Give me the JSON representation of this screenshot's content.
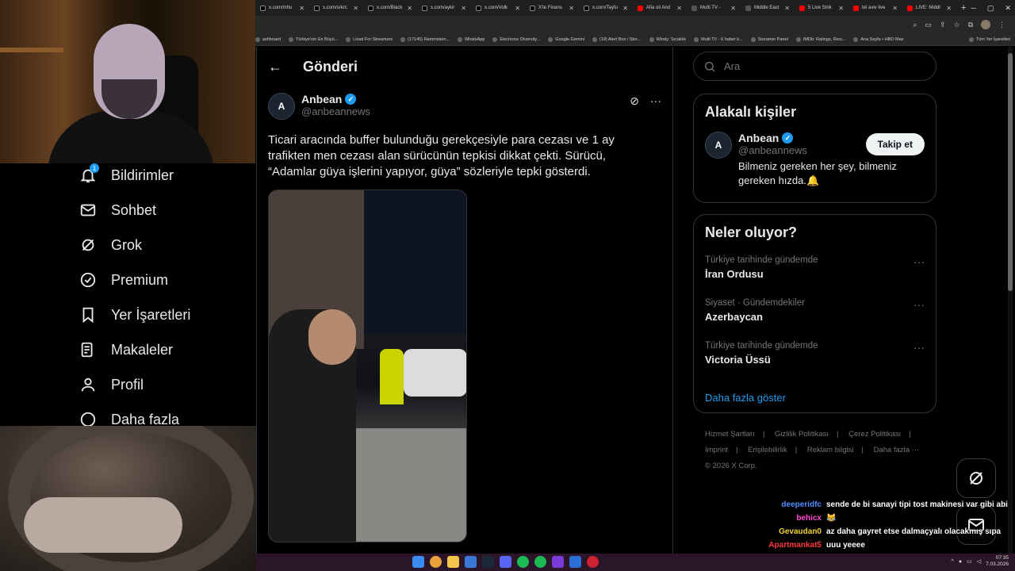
{
  "browser": {
    "tabs": [
      {
        "label": "x.com/mhu",
        "kind": "x"
      },
      {
        "label": "x.com/srkrc",
        "kind": "x"
      },
      {
        "label": "x.com/Black",
        "kind": "x"
      },
      {
        "label": "x.com/aykir",
        "kind": "x"
      },
      {
        "label": "x.com/Volk",
        "kind": "x"
      },
      {
        "label": "X'te Finans",
        "kind": "x"
      },
      {
        "label": "x.com/Tayfu",
        "kind": "x"
      },
      {
        "label": "Afia oil And",
        "kind": "yt"
      },
      {
        "label": "Multi TV -",
        "kind": "plain"
      },
      {
        "label": "Middle East",
        "kind": "plain"
      },
      {
        "label": "5 Live Strik",
        "kind": "yt"
      },
      {
        "label": "tel aviv live",
        "kind": "yt"
      },
      {
        "label": "LIVE: Middl",
        "kind": "yt"
      }
    ],
    "new_tab": "+",
    "bookmarks": [
      "ashboard",
      "Türkiye'nin En Büyü...",
      "Livad For Streamers",
      "(17145) Rammstein...",
      "WhatsApp",
      "Electronic Diversity...",
      "Google Gemini",
      "(19) Alert Box / Stre...",
      "Windy: Sıcaklık",
      "Multi TV - 6 haber k...",
      "Streamer Panel",
      "IMDb: Ratings, Revi...",
      "Ana Sayfa • HBO Max"
    ],
    "bookmarks_folder": "Tüm Yer İşaretleri"
  },
  "nav": {
    "notifications": {
      "label": "Bildirimler",
      "badge": "1"
    },
    "chat": "Sohbet",
    "grok": "Grok",
    "premium": "Premium",
    "bookmarks": "Yer İşaretleri",
    "articles": "Makaleler",
    "profile": "Profil",
    "more": "Daha fazla"
  },
  "main": {
    "title": "Gönderi",
    "post": {
      "avatar_text": "A",
      "display_name": "Anbean",
      "handle": "@anbeannews",
      "text": "Ticari aracında buffer bulunduğu gerekçesiyle para cezası ve 1 ay trafikten men cezası alan sürücünün tepkisi dikkat çekti. Sürücü, “Adamlar güya işlerini yapıyor, güya” sözleriyle tepki gösterdi."
    }
  },
  "sidebar": {
    "search_placeholder": "Ara",
    "related_title": "Alakalı kişiler",
    "related": {
      "name": "Anbean",
      "handle": "@anbeannews",
      "follow_label": "Takip et",
      "bio": "Bilmeniz gereken her şey, bilmeniz gereken hızda.🔔"
    },
    "trends_title": "Neler oluyor?",
    "trends": [
      {
        "meta": "Türkiye tarihinde gündemde",
        "name": "İran Ordusu"
      },
      {
        "meta": "Siyaset · Gündemdekiler",
        "name": "Azerbaycan"
      },
      {
        "meta": "Türkiye tarihinde gündemde",
        "name": "Victoria Üssü"
      }
    ],
    "show_more": "Daha fazla göster",
    "footer": {
      "terms": "Hizmet Şartları",
      "privacy": "Gizlilik Politikası",
      "cookies": "Çerez Politikası",
      "imprint": "Imprint",
      "accessibility": "Erişilebilirlik",
      "ads": "Reklam bilgisi",
      "more": "Daha fazla ···",
      "copyright": "© 2026 X Corp."
    }
  },
  "chat": [
    {
      "user": "deeperidfc",
      "color": "#4f8cff",
      "msg": "sende de bi sanayi tipi tost makinesi var gibi abi"
    },
    {
      "user": "behicx",
      "color": "#ff4fd0",
      "msg": "😹"
    },
    {
      "user": "Gevaudan0",
      "color": "#f5d33a",
      "msg": "az daha gayret etse dalmaçyalı olacakmış sıpa"
    },
    {
      "user": "Apartmankat5",
      "color": "#ff3b3b",
      "msg": "uuu yeeee"
    }
  ],
  "taskbar": {
    "time": "07:35",
    "date": "7.03.2026"
  },
  "colors": {
    "accent": "#1d9bf0",
    "background": "#000000",
    "border": "#2f3336",
    "muted": "#71767b"
  }
}
